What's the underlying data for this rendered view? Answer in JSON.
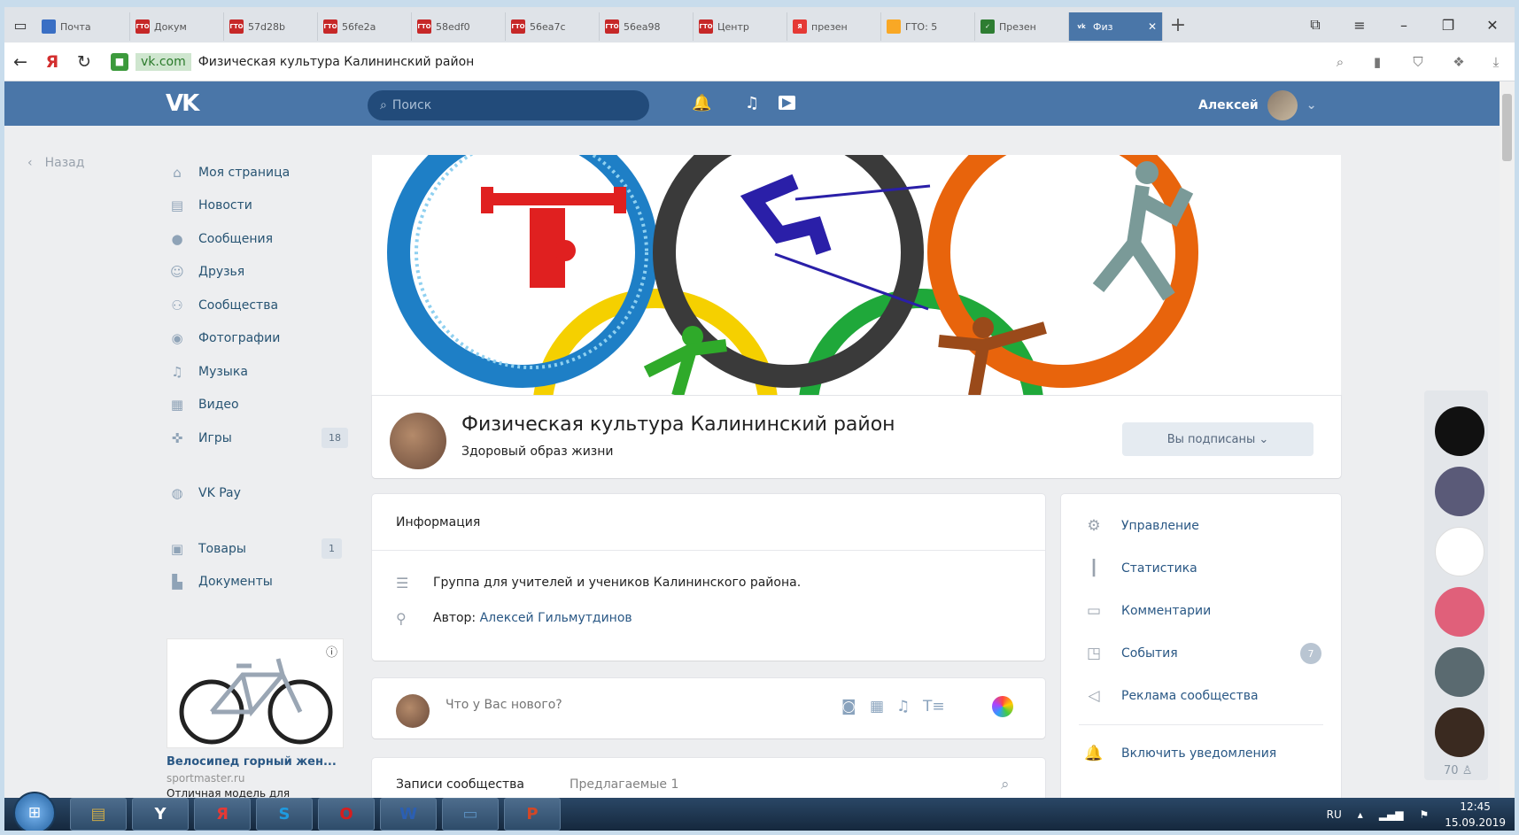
{
  "browser": {
    "tabs": [
      {
        "label": "Почта",
        "fav_color": "#3a6fc4",
        "fav_text": ""
      },
      {
        "label": "Докум",
        "fav_color": "#c62828",
        "fav_text": "ГТО"
      },
      {
        "label": "57d28b",
        "fav_color": "#c62828",
        "fav_text": "ГТО"
      },
      {
        "label": "56fe2a",
        "fav_color": "#c62828",
        "fav_text": "ГТО"
      },
      {
        "label": "58edf0",
        "fav_color": "#c62828",
        "fav_text": "ГТО"
      },
      {
        "label": "56ea7c",
        "fav_color": "#c62828",
        "fav_text": "ГТО"
      },
      {
        "label": "56ea98",
        "fav_color": "#c62828",
        "fav_text": "ГТО"
      },
      {
        "label": "Центр",
        "fav_color": "#c62828",
        "fav_text": "ГТО"
      },
      {
        "label": "презен",
        "fav_color": "#e53935",
        "fav_text": "Я"
      },
      {
        "label": "ГТО: 5",
        "fav_color": "#f9a825",
        "fav_text": ""
      },
      {
        "label": "Презен",
        "fav_color": "#2e7d32",
        "fav_text": "✓"
      },
      {
        "label": "Физ",
        "fav_color": "#4a76a8",
        "fav_text": "vk"
      }
    ],
    "domain": "vk.com",
    "page_title": "Физическая культура Калининский район"
  },
  "vk": {
    "search_placeholder": "Поиск",
    "user_name": "Алексей",
    "back": "Назад",
    "nav": [
      {
        "icon": "home-icon",
        "glyph": "⌂",
        "label": "Моя страница",
        "count": ""
      },
      {
        "icon": "news-icon",
        "glyph": "▤",
        "label": "Новости",
        "count": ""
      },
      {
        "icon": "messages-icon",
        "glyph": "●",
        "label": "Сообщения",
        "count": ""
      },
      {
        "icon": "friends-icon",
        "glyph": "☺",
        "label": "Друзья",
        "count": ""
      },
      {
        "icon": "communities-icon",
        "glyph": "⚇",
        "label": "Сообщества",
        "count": ""
      },
      {
        "icon": "photos-icon",
        "glyph": "◉",
        "label": "Фотографии",
        "count": ""
      },
      {
        "icon": "music-icon",
        "glyph": "♫",
        "label": "Музыка",
        "count": ""
      },
      {
        "icon": "video-icon",
        "glyph": "▦",
        "label": "Видео",
        "count": ""
      },
      {
        "icon": "games-icon",
        "glyph": "✜",
        "label": "Игры",
        "count": "18"
      },
      {
        "icon": "vkpay-icon",
        "glyph": "◍",
        "label": "VK Pay",
        "count": ""
      },
      {
        "icon": "goods-icon",
        "glyph": "▣",
        "label": "Товары",
        "count": "1"
      },
      {
        "icon": "documents-icon",
        "glyph": "▙",
        "label": "Документы",
        "count": ""
      }
    ],
    "ad": {
      "title": "Велосипед горный жен...",
      "domain": "sportmaster.ru",
      "desc": "Отличная модель для"
    },
    "group": {
      "name": "Физическая культура Калининский район",
      "status": "Здоровый образ жизни",
      "subscribe_btn": "Вы подписаны ⌄"
    },
    "info": {
      "heading": "Информация",
      "description": "Группа для учителей и учеников Калининского района.",
      "author_label": "Автор:",
      "author_name": "Алексей Гильмутдинов"
    },
    "post_placeholder": "Что у Вас нового?",
    "wall": {
      "tab_own": "Записи сообщества",
      "tab_suggested": "Предлагаемые  1"
    },
    "management": [
      {
        "icon": "settings-icon",
        "glyph": "⚙",
        "label": "Управление",
        "badge": ""
      },
      {
        "icon": "stats-icon",
        "glyph": "┃",
        "label": "Статистика",
        "badge": ""
      },
      {
        "icon": "comments-icon",
        "glyph": "▭",
        "label": "Комментарии",
        "badge": ""
      },
      {
        "icon": "events-icon",
        "glyph": "◳",
        "label": "События",
        "badge": "7"
      },
      {
        "icon": "ads-icon",
        "glyph": "◁",
        "label": "Реклама сообщества",
        "badge": ""
      }
    ],
    "notifications": "Включить уведомления",
    "online_count": "70"
  },
  "taskbar": {
    "apps": [
      {
        "name": "explorer",
        "glyph": "▤"
      },
      {
        "name": "yandex",
        "glyph": "Y"
      },
      {
        "name": "yandex-browser",
        "glyph": "Я"
      },
      {
        "name": "skype",
        "glyph": "S"
      },
      {
        "name": "opera",
        "glyph": "O"
      },
      {
        "name": "word",
        "glyph": "W"
      },
      {
        "name": "desktop",
        "glyph": "▭"
      },
      {
        "name": "powerpoint",
        "glyph": "P"
      }
    ],
    "lang": "RU",
    "time": "12:45",
    "date": "15.09.2019"
  }
}
